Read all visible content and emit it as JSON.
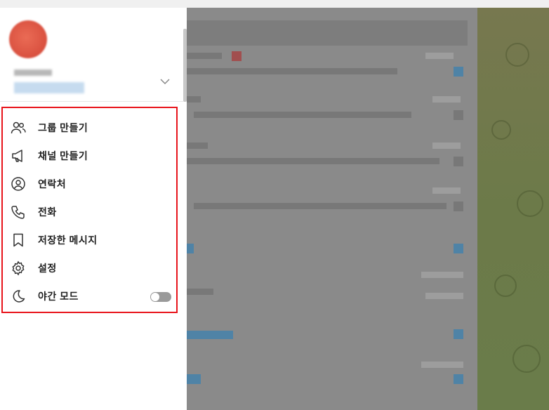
{
  "drawer": {
    "menu": [
      {
        "label": "그룹 만들기",
        "icon": "users-icon"
      },
      {
        "label": "채널 만들기",
        "icon": "megaphone-icon"
      },
      {
        "label": "연락처",
        "icon": "contact-icon"
      },
      {
        "label": "전화",
        "icon": "phone-icon"
      },
      {
        "label": "저장한 메시지",
        "icon": "bookmark-icon"
      },
      {
        "label": "설정",
        "icon": "gear-icon"
      },
      {
        "label": "야간 모드",
        "icon": "moon-icon"
      }
    ],
    "night_mode_on": false
  },
  "colors": {
    "highlight_border": "#e8141b",
    "avatar": "#e05c48",
    "chat_background": "#707a4b"
  }
}
